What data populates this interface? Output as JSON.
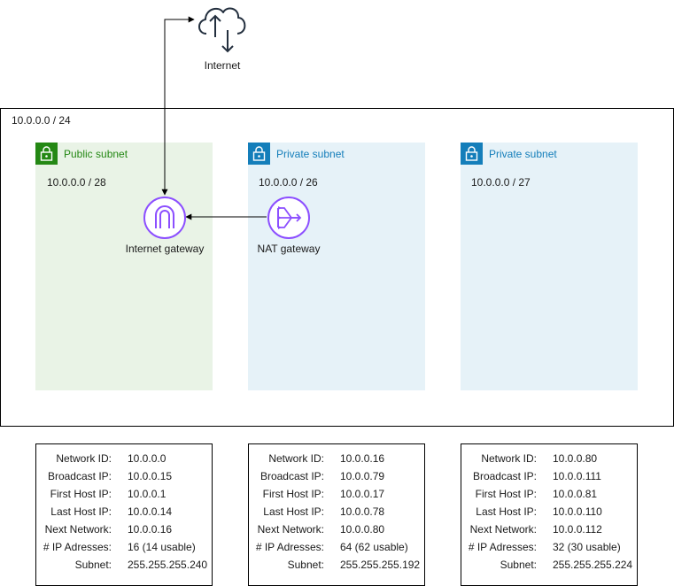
{
  "internet": {
    "label": "Internet",
    "icon": "cloud-upload-download-icon"
  },
  "vpc": {
    "cidr": "10.0.0.0 / 24"
  },
  "subnets": [
    {
      "title": "Public subnet",
      "cidr": "10.0.0.0 / 28",
      "color": "#248814",
      "background": "#e9f3e6",
      "icon": "lock-icon"
    },
    {
      "title": "Private subnet",
      "cidr": "10.0.0.0 / 26",
      "color": "#147eba",
      "background": "#e6f2f8",
      "icon": "lock-icon"
    },
    {
      "title": "Private subnet",
      "cidr": "10.0.0.0 / 27",
      "color": "#147eba",
      "background": "#e6f2f8",
      "icon": "lock-icon"
    }
  ],
  "nodes": {
    "internet_gateway": {
      "label": "Internet gateway",
      "color": "#8c4fff",
      "icon": "internet-gateway-icon"
    },
    "nat_gateway": {
      "label": "NAT gateway",
      "color": "#8c4fff",
      "icon": "nat-gateway-icon"
    }
  },
  "info_boxes": [
    {
      "rows": [
        {
          "key": "Network ID:",
          "value": "10.0.0.0"
        },
        {
          "key": "Broadcast IP:",
          "value": "10.0.0.15"
        },
        {
          "key": "First Host IP:",
          "value": "10.0.0.1"
        },
        {
          "key": "Last Host IP:",
          "value": "10.0.0.14"
        },
        {
          "key": "Next Network:",
          "value": "10.0.0.16"
        },
        {
          "key": "# IP Adresses:",
          "value": "16 (14 usable)"
        },
        {
          "key": "Subnet:",
          "value": "255.255.255.240"
        }
      ]
    },
    {
      "rows": [
        {
          "key": "Network ID:",
          "value": "10.0.0.16"
        },
        {
          "key": "Broadcast IP:",
          "value": "10.0.0.79"
        },
        {
          "key": "First Host IP:",
          "value": "10.0.0.17"
        },
        {
          "key": "Last Host IP:",
          "value": "10.0.0.78"
        },
        {
          "key": "Next Network:",
          "value": "10.0.0.80"
        },
        {
          "key": "# IP Adresses:",
          "value": "64 (62 usable)"
        },
        {
          "key": "Subnet:",
          "value": "255.255.255.192"
        }
      ]
    },
    {
      "rows": [
        {
          "key": "Network ID:",
          "value": "10.0.0.80"
        },
        {
          "key": "Broadcast IP:",
          "value": "10.0.0.111"
        },
        {
          "key": "First Host IP:",
          "value": "10.0.0.81"
        },
        {
          "key": "Last Host IP:",
          "value": "10.0.0.110"
        },
        {
          "key": "Next Network:",
          "value": "10.0.0.112"
        },
        {
          "key": "# IP Adresses:",
          "value": "32 (30 usable)"
        },
        {
          "key": "Subnet:",
          "value": "255.255.255.224"
        }
      ]
    }
  ]
}
